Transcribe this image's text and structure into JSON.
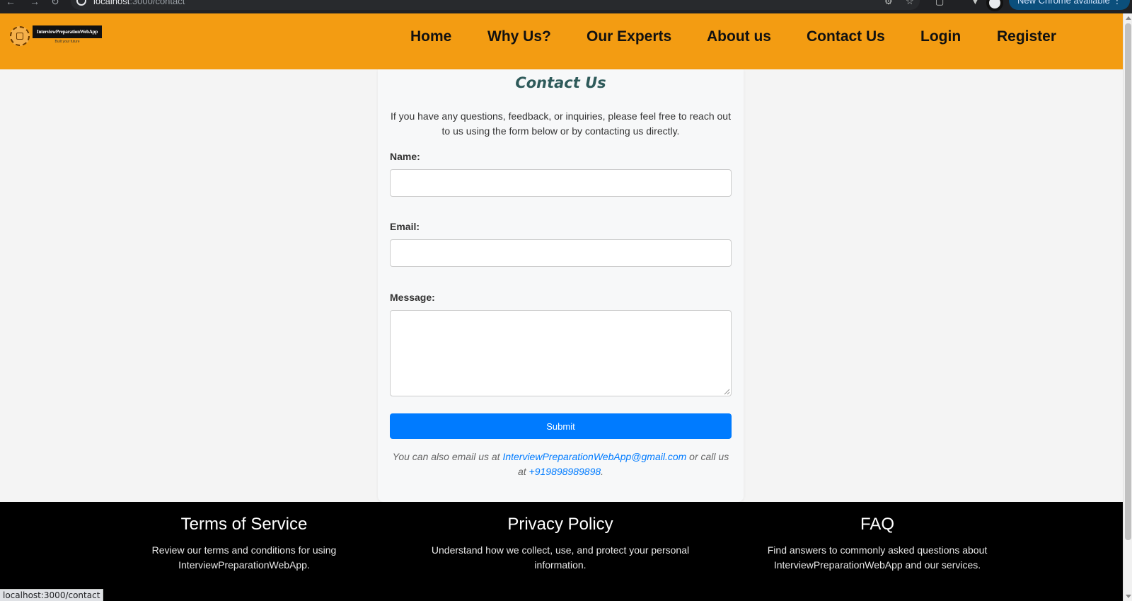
{
  "browser": {
    "url_host": "localhost",
    "url_path": ":3000/contact",
    "update_label": "New Chrome available"
  },
  "header": {
    "logo_title": "InterviewPreparationWebApp",
    "logo_tagline": "Built your future",
    "nav": [
      "Home",
      "Why Us?",
      "Our Experts",
      "About us",
      "Contact Us",
      "Login",
      "Register"
    ]
  },
  "contact": {
    "title": "Contact Us",
    "intro": "If you have any questions, feedback, or inquiries, please feel free to reach out to us using the form below or by contacting us directly.",
    "name_label": "Name:",
    "name_value": "",
    "email_label": "Email:",
    "email_value": "",
    "message_label": "Message:",
    "message_value": "",
    "submit_label": "Submit",
    "also_prefix": "You can also email us at ",
    "email_link": "InterviewPreparationWebApp@gmail.com",
    "also_middle": " or call us at ",
    "phone_link": "+919898989898",
    "also_suffix": "."
  },
  "footer": {
    "columns": [
      {
        "title": "Terms of Service",
        "text": "Review our terms and conditions for using InterviewPreparationWebApp."
      },
      {
        "title": "Privacy Policy",
        "text": "Understand how we collect, use, and protect your personal information."
      },
      {
        "title": "FAQ",
        "text": "Find answers to commonly asked questions about InterviewPreparationWebApp and our services."
      }
    ]
  },
  "status_bar": {
    "text": "localhost:3000/contact"
  },
  "colors": {
    "header": "#f39c12",
    "primary": "#007bff",
    "footer": "#000000",
    "title": "#2e5a5a"
  }
}
